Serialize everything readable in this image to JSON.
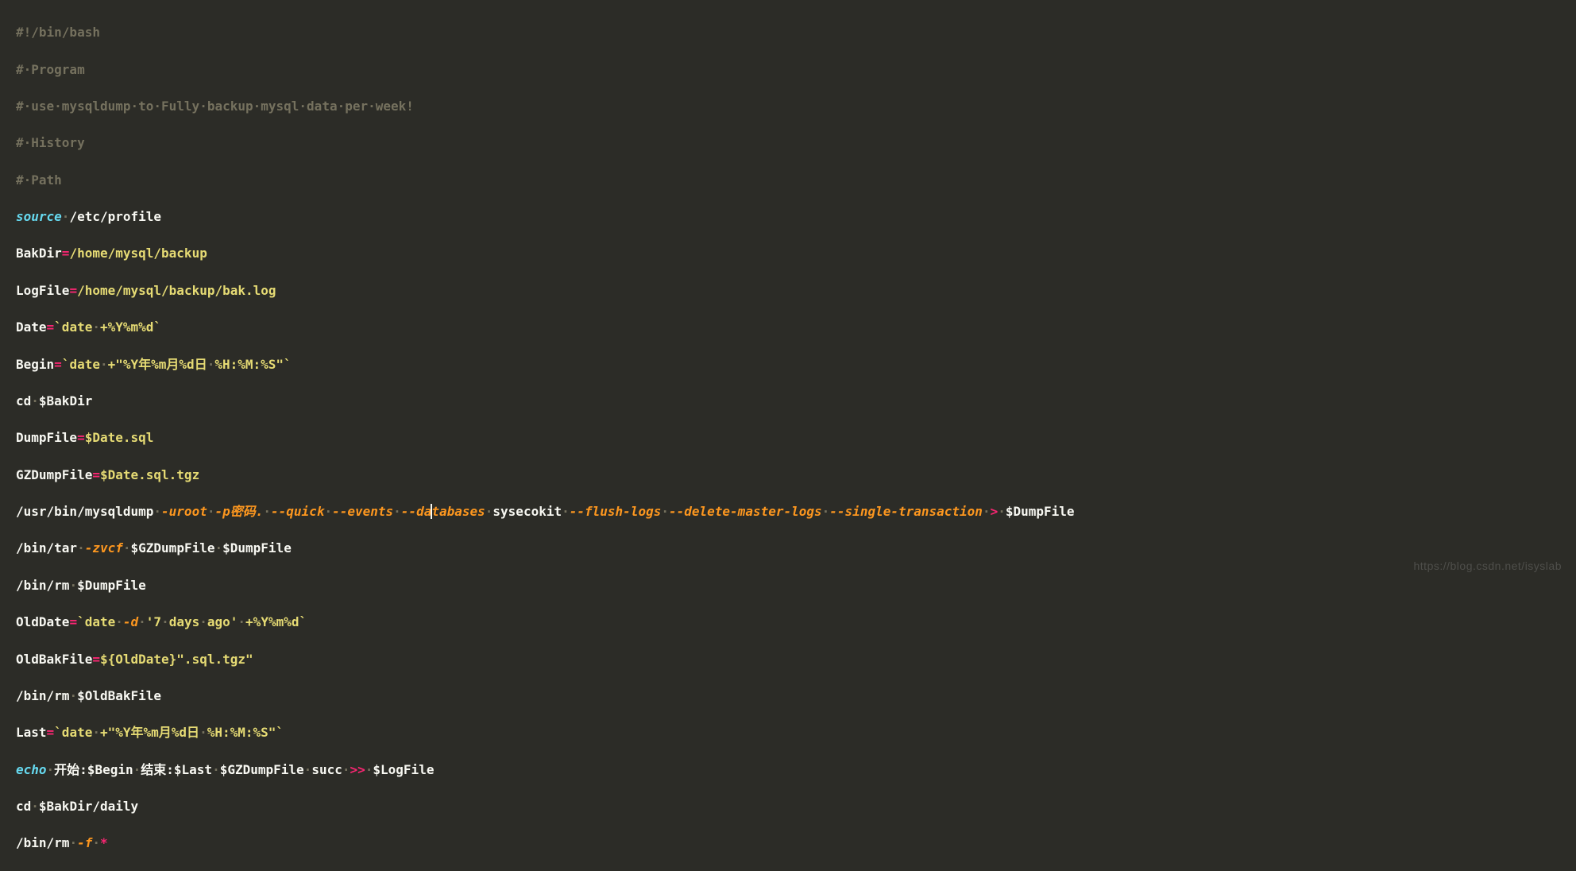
{
  "lines": {
    "l1_shebang": "#!/bin/bash",
    "l2_program": "#·Program",
    "l3_desc": "#·use·mysqldump·to·Fully·backup·mysql·data·per·week!",
    "l4_history": "#·History",
    "l5_path": "#·Path",
    "l6_source": "source",
    "l6_arg": "/etc/profile",
    "l7_var": "BakDir",
    "l7_val": "/home/mysql/backup",
    "l8_var": "LogFile",
    "l8_val": "/home/mysql/backup/bak.log",
    "l9_var": "Date",
    "l9_val_a": "`date",
    "l9_val_b": "+%Y%m%d`",
    "l10_var": "Begin",
    "l10_val_a": "`date",
    "l10_val_b": "+\"%Y年%m月%d日",
    "l10_val_c": "%H:%M:%S\"`",
    "l11_cmd": "cd",
    "l11_arg": "$BakDir",
    "l12_var": "DumpFile",
    "l12_val": "$Date.sql",
    "l13_var": "GZDumpFile",
    "l13_val": "$Date.sql.tgz",
    "l14_cmd": "/usr/bin/mysqldump",
    "l14_o1": "-uroot",
    "l14_o2": "-p密码.",
    "l14_o3": "--quick",
    "l14_o4": "--events",
    "l14_o5a": "--da",
    "l14_o5b": "tabases",
    "l14_db": "sysecokit",
    "l14_o6": "--flush-logs",
    "l14_o7": "--delete-master-logs",
    "l14_o8": "--single-transaction",
    "l14_redir": ">",
    "l14_out": "$DumpFile",
    "l15_cmd": "/bin/tar",
    "l15_o1": "-zvcf",
    "l15_a1": "$GZDumpFile",
    "l15_a2": "$DumpFile",
    "l16_cmd": "/bin/rm",
    "l16_a1": "$DumpFile",
    "l17_var": "OldDate",
    "l17_a": "`date",
    "l17_o": "-d",
    "l17_b": "'7",
    "l17_c": "days",
    "l17_d": "ago'",
    "l17_e": "+%Y%m%d`",
    "l18_var": "OldBakFile",
    "l18_val": "${OldDate}\".sql.tgz\"",
    "l19_cmd": "/bin/rm",
    "l19_a1": "$OldBakFile",
    "l20_var": "Last",
    "l20_a": "`date",
    "l20_b": "+\"%Y年%m月%d日",
    "l20_c": "%H:%M:%S\"`",
    "l21_cmd": "echo",
    "l21_a": "开始:$Begin",
    "l21_b": "结束:$Last",
    "l21_c": "$GZDumpFile",
    "l21_d": "succ",
    "l21_redir": ">>",
    "l21_out": "$LogFile",
    "l22_cmd": "cd",
    "l22_a": "$BakDir/daily",
    "l23_cmd": "/bin/rm",
    "l23_o": "-f",
    "l23_a": "*"
  },
  "dot": "·",
  "watermark": "https://blog.csdn.net/isyslab"
}
